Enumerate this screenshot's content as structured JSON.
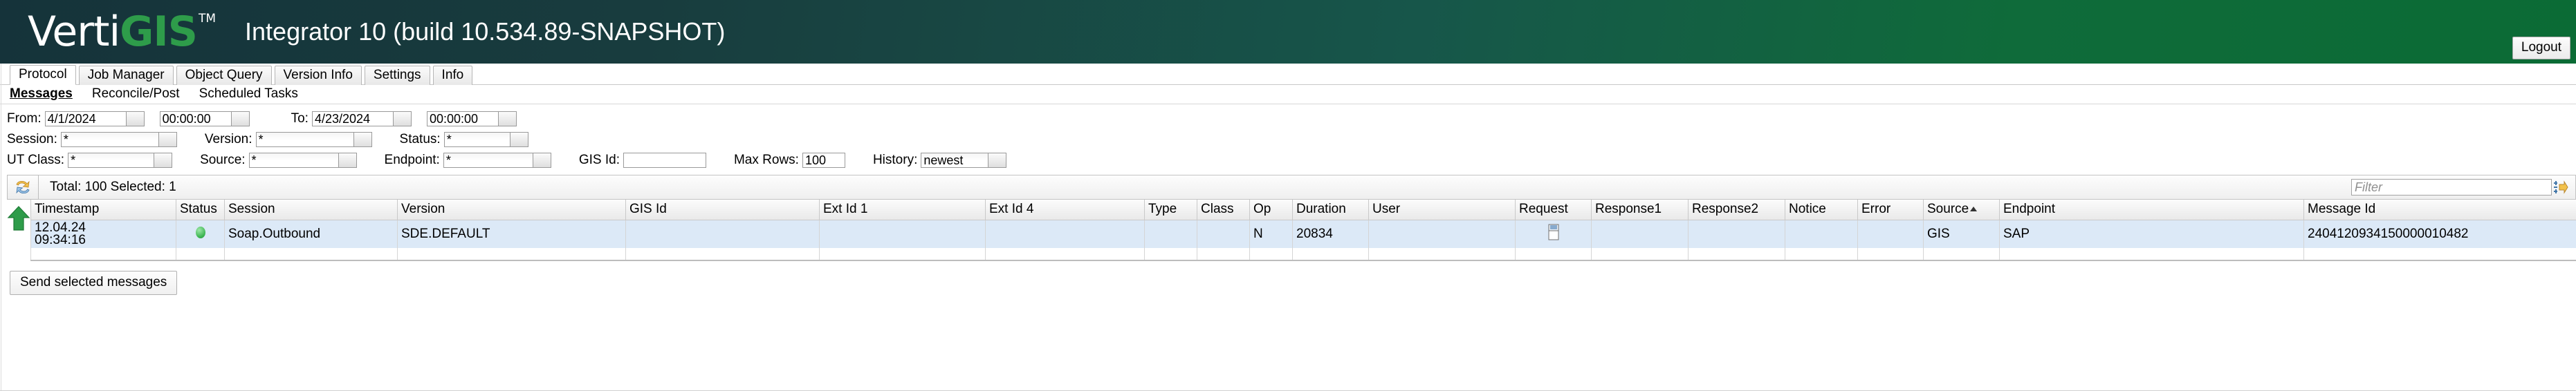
{
  "header": {
    "logo_verti": "Verti",
    "logo_gis": "GIS",
    "logo_tm": "TM",
    "title": "Integrator 10 (build 10.534.89-SNAPSHOT)",
    "logout_label": "Logout",
    "brand_green": "#2e9c4a",
    "bar_dark": "#15333a"
  },
  "tabs": [
    {
      "label": "Protocol",
      "active": true
    },
    {
      "label": "Job Manager",
      "active": false
    },
    {
      "label": "Object Query",
      "active": false
    },
    {
      "label": "Version Info",
      "active": false
    },
    {
      "label": "Settings",
      "active": false
    },
    {
      "label": "Info",
      "active": false
    }
  ],
  "subtabs": [
    {
      "label": "Messages",
      "active": true
    },
    {
      "label": "Reconcile/Post",
      "active": false
    },
    {
      "label": "Scheduled Tasks",
      "active": false
    }
  ],
  "filters": {
    "from_label": "From:",
    "from_date": "4/1/2024",
    "from_time": "00:00:00",
    "to_label": "To:",
    "to_date": "4/23/2024",
    "to_time": "00:00:00",
    "session_label": "Session:",
    "session_value": "*",
    "version_label": "Version:",
    "version_value": "*",
    "status_label": "Status:",
    "status_value": "*",
    "utclass_label": "UT Class:",
    "utclass_value": "*",
    "source_label": "Source:",
    "source_value": "*",
    "endpoint_label": "Endpoint:",
    "endpoint_value": "*",
    "gisid_label": "GIS Id:",
    "gisid_value": "",
    "maxrows_label": "Max Rows:",
    "maxrows_value": "100",
    "history_label": "History:",
    "history_value": "newest"
  },
  "toolbar": {
    "total_text": "Total: 100 Selected: 1",
    "filter_placeholder": "Filter",
    "filter_value": "",
    "refresh_icon": "refresh-messages-icon",
    "apply_filter_icon": "apply-filter-icon"
  },
  "grid": {
    "columns": [
      {
        "label": "Timestamp",
        "sorted": ""
      },
      {
        "label": "Status",
        "sorted": ""
      },
      {
        "label": "Session",
        "sorted": ""
      },
      {
        "label": "Version",
        "sorted": ""
      },
      {
        "label": "GIS Id",
        "sorted": ""
      },
      {
        "label": "Ext Id 1",
        "sorted": ""
      },
      {
        "label": "Ext Id 4",
        "sorted": ""
      },
      {
        "label": "Type",
        "sorted": ""
      },
      {
        "label": "Class",
        "sorted": ""
      },
      {
        "label": "Op",
        "sorted": ""
      },
      {
        "label": "Duration",
        "sorted": ""
      },
      {
        "label": "User",
        "sorted": ""
      },
      {
        "label": "Request",
        "sorted": ""
      },
      {
        "label": "Response1",
        "sorted": ""
      },
      {
        "label": "Response2",
        "sorted": ""
      },
      {
        "label": "Notice",
        "sorted": ""
      },
      {
        "label": "Error",
        "sorted": ""
      },
      {
        "label": "Source",
        "sorted": "asc"
      },
      {
        "label": "Endpoint",
        "sorted": ""
      },
      {
        "label": "Message Id",
        "sorted": ""
      }
    ],
    "rows": [
      {
        "timestamp_date": "12.04.24",
        "timestamp_time": "09:34:16",
        "status": "ok",
        "session": "Soap.Outbound",
        "version": "SDE.DEFAULT",
        "gis_id": "",
        "ext_id_1": "",
        "ext_id_4": "",
        "type": "",
        "class": "",
        "op": "N",
        "duration": "20834",
        "user": "",
        "request": "document-icon",
        "response1": "",
        "response2": "",
        "notice": "",
        "error": "",
        "source": "GIS",
        "endpoint": "SAP",
        "message_id": "2404120934150000010482"
      }
    ]
  },
  "footer": {
    "send_selected_label": "Send selected messages"
  }
}
